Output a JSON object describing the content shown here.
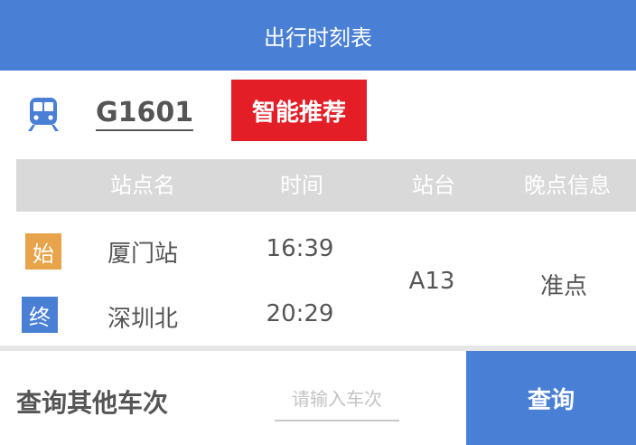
{
  "header": {
    "title": "出行时刻表"
  },
  "train": {
    "icon": "train-icon",
    "number": "G1601",
    "recommend_label": "智能推荐"
  },
  "table": {
    "columns": [
      "站点名",
      "时间",
      "站台",
      "晚点信息"
    ],
    "start": {
      "badge": "始",
      "station": "厦门站",
      "time": "16:39"
    },
    "end": {
      "badge": "终",
      "station": "深圳北",
      "time": "20:29"
    },
    "platform": "A13",
    "delay_info": "准点"
  },
  "query": {
    "title": "查询其他车次",
    "placeholder": "请输入车次",
    "button_label": "查询"
  },
  "colors": {
    "primary": "#4a7fd6",
    "recommend": "#e41e26",
    "start_badge": "#e8a44a",
    "end_badge": "#4a7fd6",
    "table_head": "#d9d9d9"
  }
}
